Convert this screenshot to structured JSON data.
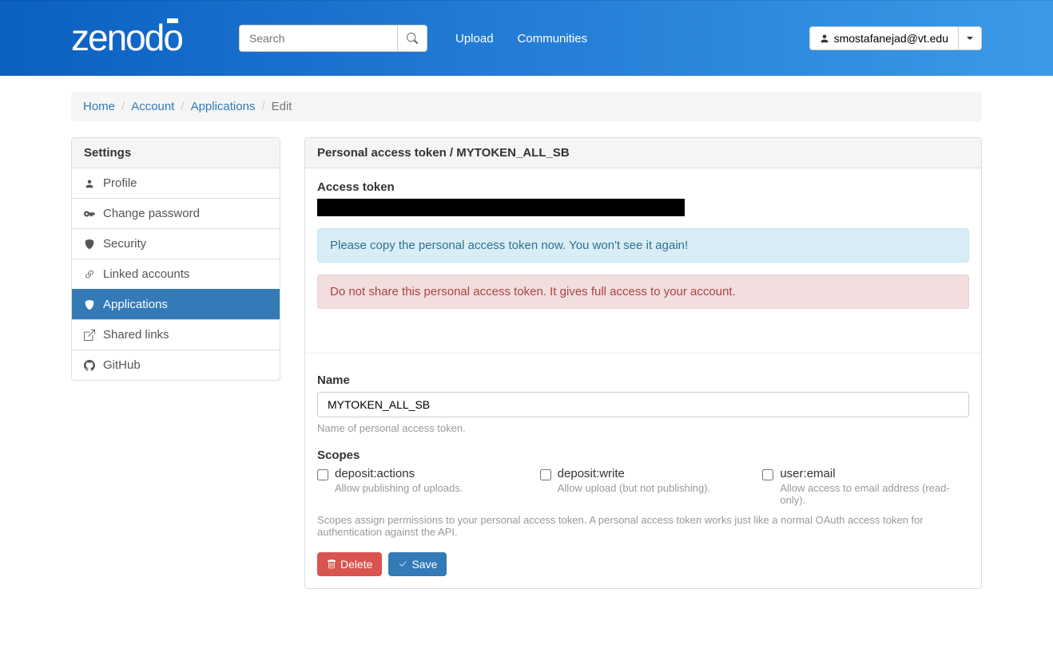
{
  "navbar": {
    "logo": "zenodo",
    "search_placeholder": "Search",
    "upload": "Upload",
    "communities": "Communities",
    "user": "smostafanejad@vt.edu"
  },
  "breadcrumb": {
    "home": "Home",
    "account": "Account",
    "applications": "Applications",
    "edit": "Edit"
  },
  "sidebar": {
    "heading": "Settings",
    "items": [
      {
        "label": "Profile"
      },
      {
        "label": "Change password"
      },
      {
        "label": "Security"
      },
      {
        "label": "Linked accounts"
      },
      {
        "label": "Applications"
      },
      {
        "label": "Shared links"
      },
      {
        "label": "GitHub"
      }
    ]
  },
  "main": {
    "heading": "Personal access token / MYTOKEN_ALL_SB",
    "access_token_label": "Access token",
    "info_message": "Please copy the personal access token now. You won't see it again!",
    "danger_message": "Do not share this personal access token. It gives full access to your account.",
    "name_label": "Name",
    "name_value": "MYTOKEN_ALL_SB",
    "name_help": "Name of personal access token.",
    "scopes_label": "Scopes",
    "scopes": [
      {
        "name": "deposit:actions",
        "desc": "Allow publishing of uploads."
      },
      {
        "name": "deposit:write",
        "desc": "Allow upload (but not publishing)."
      },
      {
        "name": "user:email",
        "desc": "Allow access to email address (read-only)."
      }
    ],
    "scopes_help": "Scopes assign permissions to your personal access token. A personal access token works just like a normal OAuth access token for authentication against the API.",
    "delete_label": "Delete",
    "save_label": "Save"
  }
}
